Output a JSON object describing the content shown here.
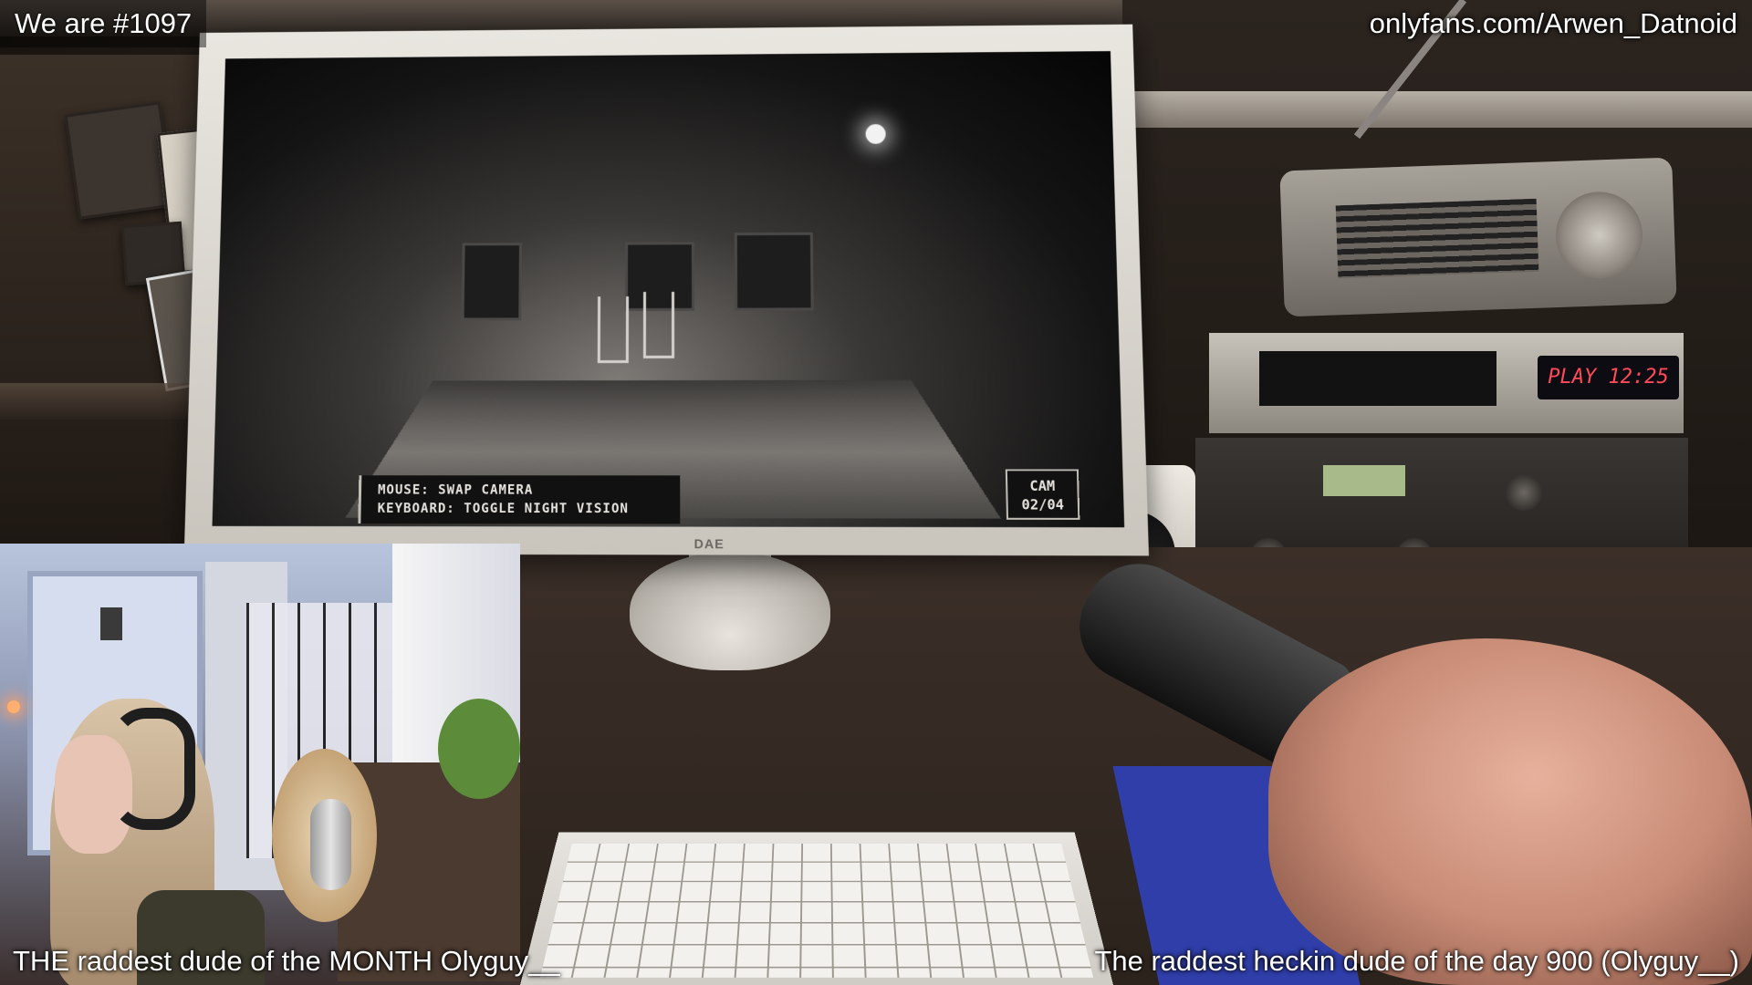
{
  "overlay": {
    "counter": "We are #1097",
    "link": "onlyfans.com/Arwen_Datnoid",
    "bottom_left": "THE raddest dude of the MONTH Olyguy__",
    "bottom_right": "The raddest heckin dude of the day 900 (Olyguy__)"
  },
  "game": {
    "hint_line1": "MOUSE: SWAP CAMERA",
    "hint_line2": "KEYBOARD: TOGGLE NIGHT VISION",
    "cam_label": "CAM",
    "cam_number": "02/04",
    "monitor_brand": "DAE",
    "deck_display": "PLAY 12:25"
  },
  "colors": {
    "overlay_text": "#ffffff",
    "deck_led": "#ff4a5a",
    "mousepad": "#2f3ea8"
  }
}
